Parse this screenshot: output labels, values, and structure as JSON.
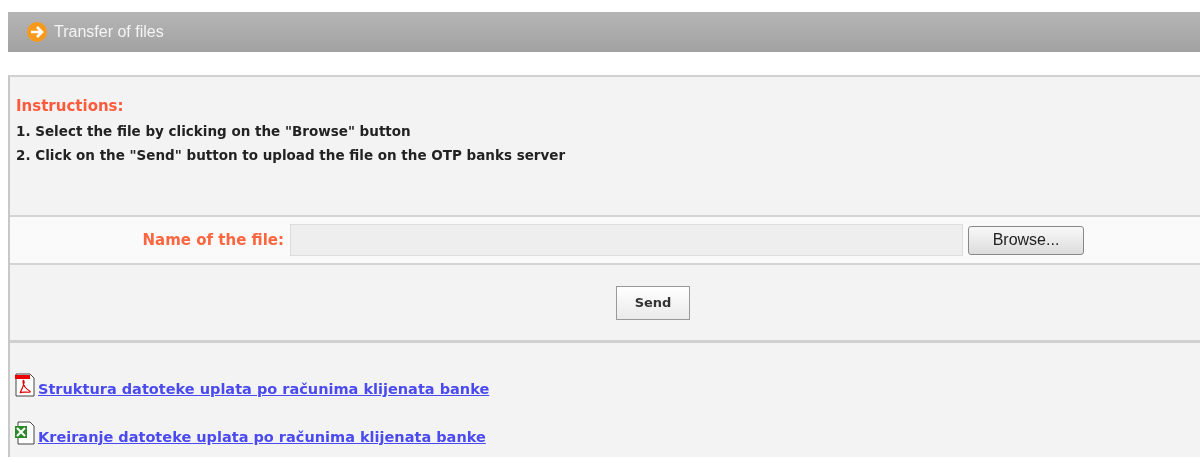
{
  "header": {
    "title": "Transfer of files"
  },
  "instructions": {
    "heading": "Instructions:",
    "steps": [
      "1. Select the file by clicking on the \"Browse\" button",
      "2. Click on the \"Send\" button to upload the file on the OTP banks server"
    ]
  },
  "file_field": {
    "label": "Name of the file:",
    "browse_button": "Browse..."
  },
  "send_button": "Send",
  "links": [
    {
      "kind": "pdf",
      "label": "Struktura datoteke uplata po računima klijenata banke"
    },
    {
      "kind": "excel",
      "label": "Kreiranje datoteke uplata po računima klijenata banke"
    }
  ]
}
